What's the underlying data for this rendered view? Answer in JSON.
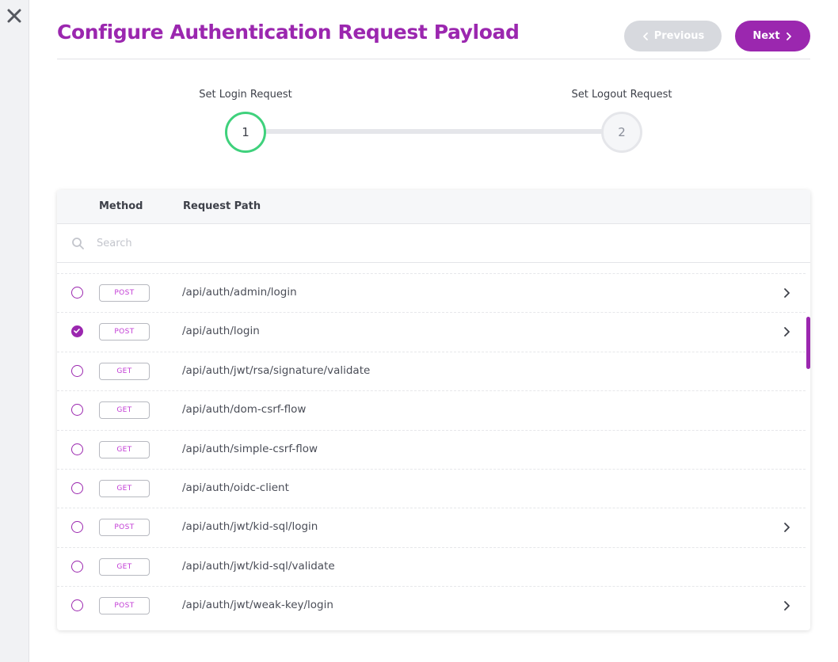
{
  "header": {
    "title": "Configure Authentication Request Payload",
    "previous_label": "Previous",
    "next_label": "Next"
  },
  "stepper": {
    "steps": [
      {
        "label": "Set Login Request",
        "number": "1",
        "state": "active"
      },
      {
        "label": "Set Logout Request",
        "number": "2",
        "state": "pending"
      }
    ]
  },
  "table": {
    "columns": {
      "method": "Method",
      "path": "Request Path"
    },
    "search": {
      "placeholder": "Search",
      "value": ""
    },
    "rows": [
      {
        "method": "POST",
        "path": "/api/auth/admin/login",
        "selected": false,
        "expandable": true
      },
      {
        "method": "POST",
        "path": "/api/auth/login",
        "selected": true,
        "expandable": true
      },
      {
        "method": "GET",
        "path": "/api/auth/jwt/rsa/signature/validate",
        "selected": false,
        "expandable": false
      },
      {
        "method": "GET",
        "path": "/api/auth/dom-csrf-flow",
        "selected": false,
        "expandable": false
      },
      {
        "method": "GET",
        "path": "/api/auth/simple-csrf-flow",
        "selected": false,
        "expandable": false
      },
      {
        "method": "GET",
        "path": "/api/auth/oidc-client",
        "selected": false,
        "expandable": false
      },
      {
        "method": "POST",
        "path": "/api/auth/jwt/kid-sql/login",
        "selected": false,
        "expandable": true
      },
      {
        "method": "GET",
        "path": "/api/auth/jwt/kid-sql/validate",
        "selected": false,
        "expandable": false
      },
      {
        "method": "POST",
        "path": "/api/auth/jwt/weak-key/login",
        "selected": false,
        "expandable": true
      }
    ]
  },
  "icons": {
    "close": "close-icon",
    "previous": "chevron-left-icon",
    "next": "chevron-right-icon",
    "search": "search-icon",
    "check": "check-icon",
    "row_expand": "chevron-right-icon"
  },
  "colors": {
    "accent": "#9b27af",
    "badge_text": "#c23bd5",
    "step_active": "#3fd17c",
    "disabled_button": "#d7d9de"
  }
}
